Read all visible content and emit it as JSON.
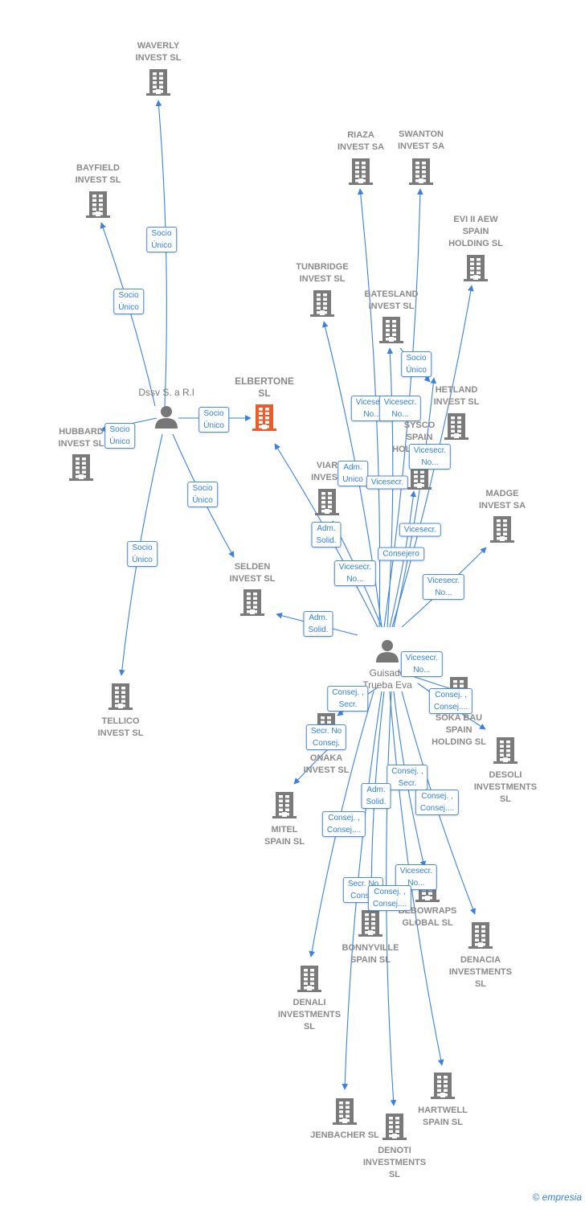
{
  "colors": {
    "edge": "#3b82e0",
    "company": "#7a7a7a",
    "focus": "#f05a28",
    "person": "#777777"
  },
  "nodes": [
    {
      "id": "waverly",
      "type": "company",
      "label": "WAVERLY\nINVEST  SL"
    },
    {
      "id": "bayfield",
      "type": "company",
      "label": "BAYFIELD\nINVEST  SL"
    },
    {
      "id": "riaza",
      "type": "company",
      "label": "RIAZA\nINVEST SA"
    },
    {
      "id": "swanton",
      "type": "company",
      "label": "SWANTON\nINVEST SA"
    },
    {
      "id": "evi",
      "type": "company",
      "label": "EVI II AEW\nSPAIN\nHOLDING  SL"
    },
    {
      "id": "tunbridge",
      "type": "company",
      "label": "TUNBRIDGE\nINVEST  SL"
    },
    {
      "id": "batesland",
      "type": "company",
      "label": "BATESLAND\nINVEST  SL"
    },
    {
      "id": "hetland",
      "type": "company",
      "label": "HETLAND\nINVEST  SL"
    },
    {
      "id": "sysco",
      "type": "company",
      "label": "SYSCO\nSPAIN\nHOLDING SL"
    },
    {
      "id": "viar",
      "type": "company",
      "label": "VIAR\nINVEST"
    },
    {
      "id": "madge",
      "type": "company",
      "label": "MADGE\nINVEST SA"
    },
    {
      "id": "elbertone",
      "type": "focus",
      "label": "ELBERTONE\nSL"
    },
    {
      "id": "dssv",
      "type": "person",
      "label": "Dssv S. a R.l"
    },
    {
      "id": "hubbard",
      "type": "company",
      "label": "HUBBARD\nINVEST  SL"
    },
    {
      "id": "selden",
      "type": "company",
      "label": "SELDEN\nINVEST  SL"
    },
    {
      "id": "tellico",
      "type": "company",
      "label": "TELLICO\nINVEST  SL"
    },
    {
      "id": "guisado",
      "type": "person",
      "label": "Guisado\nTrueba Eva"
    },
    {
      "id": "soka",
      "type": "company",
      "label": "SOKA BAU\nSPAIN\nHOLDING  SL"
    },
    {
      "id": "desoli",
      "type": "company",
      "label": "DESOLI\nINVESTMENTS\nSL"
    },
    {
      "id": "onaka",
      "type": "company",
      "label": "ONAKA\nINVEST  SL"
    },
    {
      "id": "mitel",
      "type": "company",
      "label": "MITEL\nSPAIN  SL"
    },
    {
      "id": "bebowraps",
      "type": "company",
      "label": "BEBOWRAPS\nGLOBAL  SL"
    },
    {
      "id": "bonnyville",
      "type": "company",
      "label": "BONNYVILLE\nSPAIN  SL"
    },
    {
      "id": "denacia",
      "type": "company",
      "label": "DENACIA\nINVESTMENTS\nSL"
    },
    {
      "id": "denali",
      "type": "company",
      "label": "DENALI\nINVESTMENTS\nSL"
    },
    {
      "id": "hartwell",
      "type": "company",
      "label": "HARTWELL\nSPAIN  SL"
    },
    {
      "id": "jenbacher",
      "type": "company",
      "label": "JENBACHER SL"
    },
    {
      "id": "denoti",
      "type": "company",
      "label": "DENOTI\nINVESTMENTS\nSL"
    }
  ],
  "edges": [
    {
      "from": "dssv",
      "to": "waverly",
      "label": "Socio\nÚnico"
    },
    {
      "from": "dssv",
      "to": "bayfield",
      "label": "Socio\nÚnico"
    },
    {
      "from": "dssv",
      "to": "hubbard",
      "label": "Socio\nÚnico"
    },
    {
      "from": "dssv",
      "to": "elbertone",
      "label": "Socio\nÚnico"
    },
    {
      "from": "dssv",
      "to": "selden",
      "label": "Socio\nÚnico"
    },
    {
      "from": "dssv",
      "to": "tellico",
      "label": "Socio\nÚnico"
    },
    {
      "from": "batesland",
      "to": "hetland",
      "label": "Socio\nÚnico"
    },
    {
      "from": "guisado",
      "to": "elbertone",
      "label": "Adm.\nSolid."
    },
    {
      "from": "guisado",
      "to": "viar",
      "label": "Adm.\nUnico"
    },
    {
      "from": "guisado",
      "to": "riaza",
      "label": "Vicesecr.\nNo..."
    },
    {
      "from": "guisado",
      "to": "swanton",
      "label": "Vicesecr.\nNo..."
    },
    {
      "from": "guisado",
      "to": "batesland",
      "label": "Vicesecr."
    },
    {
      "from": "guisado",
      "to": "evi",
      "label": "Vicesecr.\nNo..."
    },
    {
      "from": "guisado",
      "to": "sysco",
      "label": "Vicesecr."
    },
    {
      "from": "guisado",
      "to": "hetland",
      "label": "Consejero"
    },
    {
      "from": "guisado",
      "to": "tunbridge",
      "label": "Vicesecr.\nNo..."
    },
    {
      "from": "guisado",
      "to": "madge",
      "label": "Vicesecr.\nNo..."
    },
    {
      "from": "guisado",
      "to": "selden",
      "label": "Adm.\nSolid."
    },
    {
      "from": "guisado",
      "to": "soka",
      "label": "Vicesecr.\nNo..."
    },
    {
      "from": "guisado",
      "to": "desoli",
      "label": "Consej. ,\nConsej...."
    },
    {
      "from": "guisado",
      "to": "onaka",
      "label": "Consej. ,\nSecr."
    },
    {
      "from": "guisado",
      "to": "mitel",
      "label": "Secr.  No\nConsej."
    },
    {
      "from": "guisado",
      "to": "bebowraps",
      "label": "Consej. ,\nSecr."
    },
    {
      "from": "guisado",
      "to": "bonnyville",
      "label": "Adm.\nSolid."
    },
    {
      "from": "guisado",
      "to": "denacia",
      "label": "Consej. ,\nConsej...."
    },
    {
      "from": "guisado",
      "to": "denali",
      "label": "Consej. ,\nConsej...."
    },
    {
      "from": "guisado",
      "to": "jenbacher",
      "label": "Secr.  No\nCons..."
    },
    {
      "from": "guisado",
      "to": "hartwell",
      "label": "Vicesecr.\nNo..."
    },
    {
      "from": "guisado",
      "to": "denoti",
      "label": "Consej. ,\nConsej...."
    }
  ],
  "copyright": "© empresia"
}
